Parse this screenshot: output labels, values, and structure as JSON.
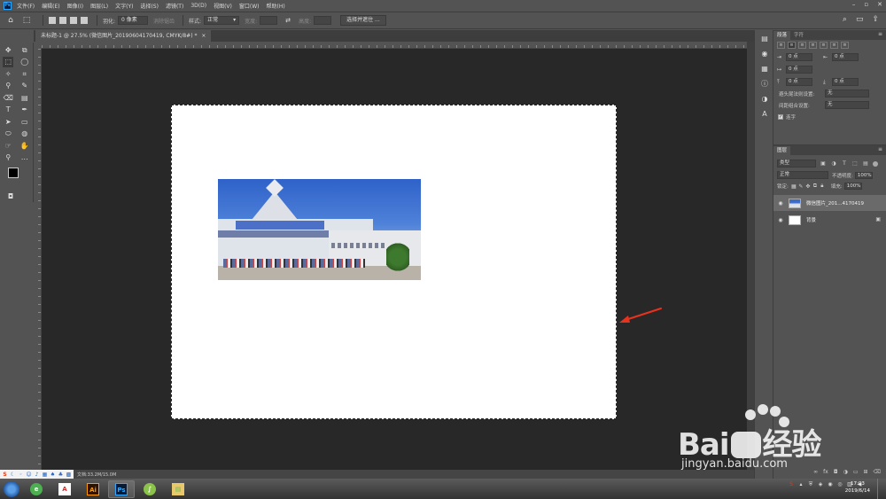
{
  "menubar": {
    "logo": "Ps",
    "items": [
      "文件(F)",
      "编辑(E)",
      "图像(I)",
      "图层(L)",
      "文字(Y)",
      "选择(S)",
      "滤镜(T)",
      "3D(D)",
      "视图(V)",
      "窗口(W)",
      "帮助(H)"
    ]
  },
  "optbar": {
    "feather_label": "羽化:",
    "feather_value": "0 像素",
    "antialias_label": "消除锯齿",
    "style_label": "样式:",
    "style_value": "正常",
    "width_label": "宽度:",
    "height_label": "高度:",
    "select_mask_button": "选择并遮住 ..."
  },
  "document_tab": {
    "title": "未标题-1 @ 27.5% (微信图片_20190604170419, CMYK/8#) *"
  },
  "status": {
    "doc_size": "文档:33.2M/15.0M"
  },
  "paragraph_panel": {
    "tabs": [
      "段落",
      "字符"
    ],
    "indent_value": "0 点",
    "kinsoku_label": "避头尾法则设置:",
    "kinsoku_value": "无",
    "mojikumi_label": "间距组合设置:",
    "mojikumi_value": "无",
    "hyphenate_label": "连字"
  },
  "layers_panel": {
    "tab": "图层",
    "filter_value": "类型",
    "blend_mode": "正常",
    "opacity_label": "不透明度:",
    "opacity_value": "100%",
    "lock_label": "锁定:",
    "fill_label": "填充:",
    "fill_value": "100%",
    "layers": [
      {
        "name": "微信图片_201...4170419"
      },
      {
        "name": "背景"
      }
    ]
  },
  "taskbar": {
    "time": "17:03",
    "date": "2019/6/14"
  },
  "watermark": {
    "brand": "Bai",
    "brand_cn": "经验",
    "url": "jingyan.baidu.com"
  },
  "colors": {
    "accent": "#31a8ff",
    "annotation_arrow": "#e8321e",
    "foreground": "#000000",
    "background": "#ffffff"
  }
}
